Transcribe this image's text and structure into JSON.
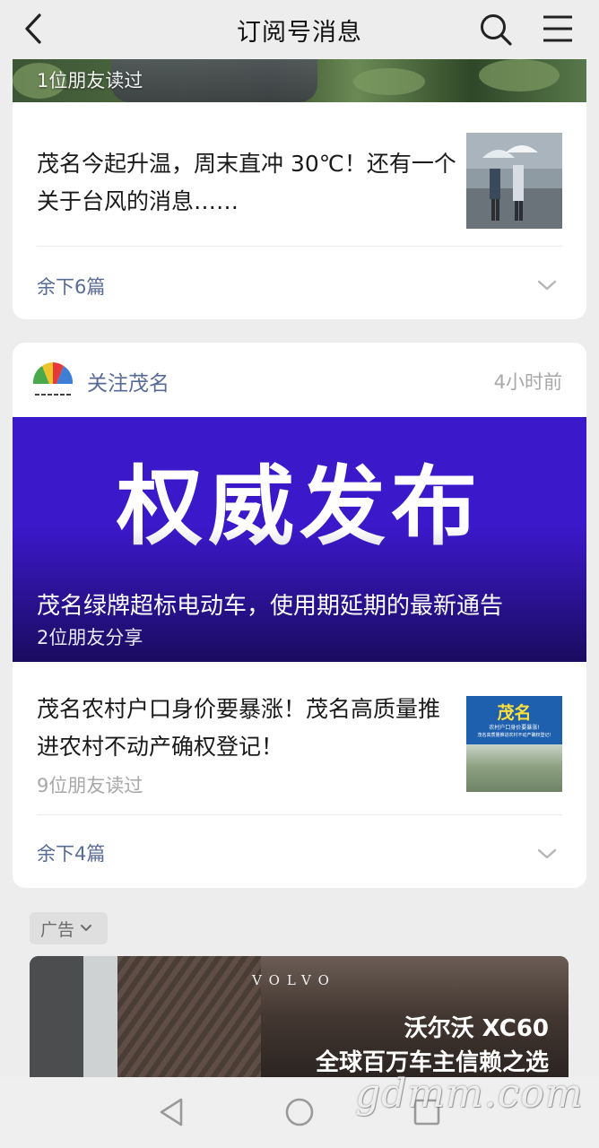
{
  "header": {
    "title": "订阅号消息",
    "back_icon": "back-arrow-icon",
    "search_icon": "search-icon",
    "menu_icon": "menu-icon"
  },
  "card1": {
    "hero_caption": "1位朋友读过",
    "article_title": "茂名今起升温，周末直冲 30℃！还有一个关于台风的消息……",
    "remaining": "余下6篇"
  },
  "card2": {
    "account_name": "关注茂名",
    "time": "4小时前",
    "banner_text": "权威发布",
    "banner_title": "茂名绿牌超标电动车，使用期延期的最新通告",
    "banner_meta": "2位朋友分享",
    "article_title": "茂名农村户口身价要暴涨！茂名高质量推进农村不动产确权登记！",
    "article_meta": "9位朋友读过",
    "thumb_title": "茂名",
    "thumb_sub1": "农村户口身价要暴涨!",
    "thumb_sub2": "茂名高质量推进农村不动产确权登记!",
    "remaining": "余下4篇"
  },
  "ad": {
    "tag": "广告",
    "brand": "VOLVO",
    "line1": "沃尔沃 XC60",
    "line2": "全球百万车主信赖之选"
  },
  "watermark": "gdmm.com",
  "colors": {
    "link": "#576b95",
    "banner": "#3b18c9",
    "meta": "#a8a8a8"
  }
}
